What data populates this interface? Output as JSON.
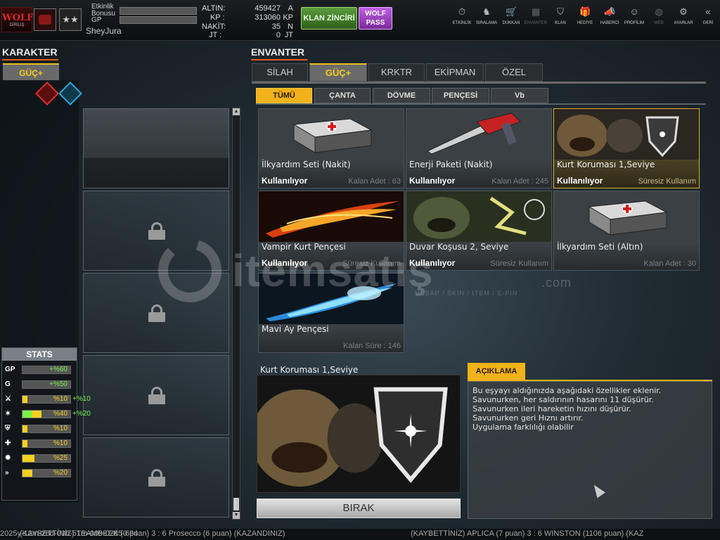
{
  "top": {
    "logo_text": "WOLF",
    "logo_sub": "DİRİLİŞ",
    "rank_stars": "★★",
    "event_bonus_label": "Etkinlik Bonusu",
    "gp_label": "GP",
    "username": "SheyJura",
    "currencies": [
      {
        "key": "ALTIN:",
        "value": "459427",
        "unit": "A"
      },
      {
        "key": "KP :",
        "value": "313060",
        "unit": "KP"
      },
      {
        "key": "NAKİT:",
        "value": "35",
        "unit": "N"
      },
      {
        "key": "JT :",
        "value": "0",
        "unit": "JT"
      }
    ],
    "clan_chain_label": "KLAN ZİNCİRİ",
    "wolf_pass_label": "WOLF PASS",
    "nav": [
      {
        "label": "ETKİNLİK",
        "icon": "stopwatch-icon",
        "glyph": "⏱"
      },
      {
        "label": "SIRALAMA",
        "icon": "wolf-head-icon",
        "glyph": "♞"
      },
      {
        "label": "DÜKKAN",
        "icon": "cart-icon",
        "glyph": "🛒"
      },
      {
        "label": "ENVANTER",
        "icon": "inventory-icon",
        "glyph": "▦"
      },
      {
        "label": "KLAN",
        "icon": "shield-icon",
        "glyph": "⛉"
      },
      {
        "label": "HEDİYE",
        "icon": "gift-icon",
        "glyph": "🎁"
      },
      {
        "label": "HABERCİ",
        "icon": "megaphone-icon",
        "glyph": "📣"
      },
      {
        "label": "PROFİLIM",
        "icon": "profile-icon",
        "glyph": "☺"
      },
      {
        "label": "WEB",
        "icon": "globe-icon",
        "glyph": "◍"
      },
      {
        "label": "AYARLAR",
        "icon": "gear-icon",
        "glyph": "⚙"
      },
      {
        "label": "GERİ",
        "icon": "back-icon",
        "glyph": "«"
      }
    ]
  },
  "left": {
    "title": "KARAKTER",
    "tab_label": "GÜÇ+",
    "stats_title": "STATS",
    "stats": [
      {
        "icon": "gp-icon",
        "glyph": "GP",
        "value": "+%60",
        "fill": 0,
        "bonus": ""
      },
      {
        "icon": "g-icon",
        "glyph": "G",
        "value": "+%50",
        "fill": 0,
        "bonus": ""
      },
      {
        "icon": "attack-icon",
        "glyph": "⚔",
        "value": "%10",
        "fill": 0.1,
        "bonus": "+%10"
      },
      {
        "icon": "speed-icon",
        "glyph": "✶",
        "value": "%40",
        "fill": 0.4,
        "bonus": "+%20"
      },
      {
        "icon": "defense-icon",
        "glyph": "⛨",
        "value": "%10",
        "fill": 0.1,
        "bonus": ""
      },
      {
        "icon": "health-icon",
        "glyph": "✚",
        "value": "%10",
        "fill": 0.1,
        "bonus": ""
      },
      {
        "icon": "critical-icon",
        "glyph": "✹",
        "value": "%25",
        "fill": 0.25,
        "bonus": ""
      },
      {
        "icon": "dash-icon",
        "glyph": "»",
        "value": "%20",
        "fill": 0.2,
        "bonus": ""
      }
    ]
  },
  "right": {
    "title": "ENVANTER",
    "tabs": [
      "SİLAH",
      "GÜÇ+",
      "KRKTR",
      "EKİPMAN",
      "ÖZEL"
    ],
    "subtabs": [
      "TÜMÜ",
      "ÇANTA",
      "DÖVME",
      "PENÇESİ",
      "Vb"
    ],
    "items": [
      {
        "name": "İlkyardım Seti (Nakit)",
        "status": "Kullanılıyor",
        "meta": "Kalan Adet : 63"
      },
      {
        "name": "Enerji Paketi (Nakit)",
        "status": "Kullanılıyor",
        "meta": "Kalan Adet : 245"
      },
      {
        "name": "Kurt Koruması 1,Seviye",
        "status": "Kullanılıyor",
        "meta": "Süresiz Kullanım"
      },
      {
        "name": "Vampir Kurt Pençesi",
        "status": "Kullanılıyor",
        "meta": "Süresiz Kullanım"
      },
      {
        "name": "Duvar Koşusu 2, Seviye",
        "status": "Kullanılıyor",
        "meta": "Süresiz Kullanım"
      },
      {
        "name": "İlkyardım Seti (Altın)",
        "status": "",
        "meta": "Kalan Adet : 30"
      },
      {
        "name": "Mavi Ay Pençesi",
        "status": "",
        "meta": "Kalan Süre : 146"
      }
    ],
    "detail_name": "Kurt Koruması 1,Seviye",
    "drop_label": "BIRAK",
    "desc_header": "AÇIKLAMA",
    "desc_lines": [
      "Bu eşyayı aldığınızda aşağıdaki özellikler eklenir.",
      "Savunurken, her saldırının hasarını 11 düşürür.",
      "Savunurken ileri hareketin hızını düşürür.",
      "Savunurken geri Hıznı artırır.",
      "Uygulama farklılığı olabilir"
    ]
  },
  "watermark": {
    "text": "itemsatış",
    "sub": "HESAP / SKIN / ITEM / E-PIN",
    "dotcom": ".com"
  },
  "ticker": {
    "left": "2025y-12m-28d-03h-51m-009-0285-694",
    "mid": "(KAYBETTİNİZ) TEAMBEEK (0 puan) 3 : 6 Prosecco (6 puan) (KAZANDINIZ)",
    "right": "(KAYBETTİNİZ) APLICA (7 puan) 3 : 6 WINSTON (1106 puan) (KAZ"
  },
  "colors": {
    "accent": "#f1b21a",
    "selected_border": "#d9b22a",
    "underline": "#e25a1a"
  }
}
